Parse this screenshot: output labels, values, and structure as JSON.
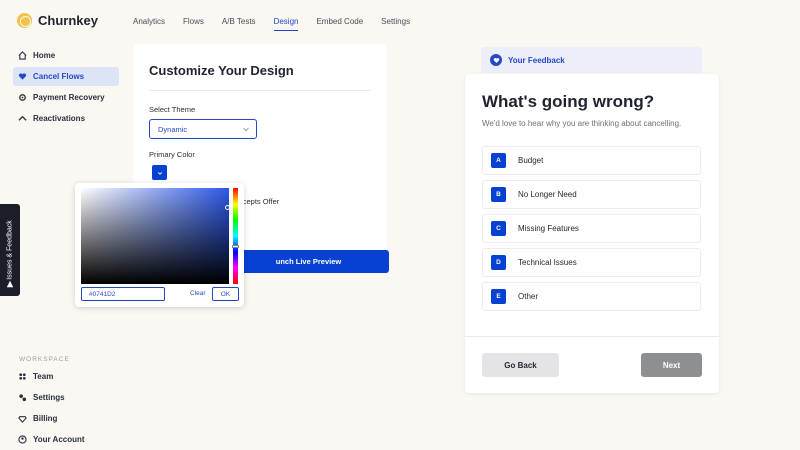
{
  "app": {
    "name": "Churnkey"
  },
  "topnav": [
    "Analytics",
    "Flows",
    "A/B Tests",
    "Design",
    "Embed Code",
    "Settings"
  ],
  "topnav_active": "Design",
  "sidebar": {
    "items": [
      {
        "label": "Home",
        "icon": "home-icon"
      },
      {
        "label": "Cancel Flows",
        "icon": "heart-icon",
        "active": true
      },
      {
        "label": "Payment Recovery",
        "icon": "gear-icon"
      },
      {
        "label": "Reactivations",
        "icon": "arrow-up-icon"
      }
    ],
    "workspace_label": "WORKSPACE",
    "workspace_items": [
      {
        "label": "Team",
        "icon": "team-icon"
      },
      {
        "label": "Settings",
        "icon": "settings-icon"
      },
      {
        "label": "Billing",
        "icon": "diamond-icon"
      },
      {
        "label": "Your Account",
        "icon": "account-icon"
      }
    ]
  },
  "design": {
    "title": "Customize Your Design",
    "theme_label": "Select Theme",
    "theme_value": "Dynamic",
    "primary_color_label": "Primary Color",
    "accepts_offer_text": "ccepts Offer",
    "launch_button": "unch Live Preview"
  },
  "picker": {
    "hex_value": "#0741D2",
    "clear_label": "Clear",
    "ok_label": "OK"
  },
  "issues_tab": {
    "label": "Issues & Feedback"
  },
  "preview": {
    "tab_label": "Your Feedback",
    "question": "What's going wrong?",
    "subtitle": "We'd love to hear why you are thinking about cancelling.",
    "options": [
      {
        "letter": "A",
        "text": "Budget"
      },
      {
        "letter": "B",
        "text": "No Longer Need"
      },
      {
        "letter": "C",
        "text": "Missing Features"
      },
      {
        "letter": "D",
        "text": "Technical Issues"
      },
      {
        "letter": "E",
        "text": "Other"
      }
    ],
    "back_label": "Go Back",
    "next_label": "Next"
  },
  "colors": {
    "primary": "#0741D2",
    "background": "#fbf7f2"
  }
}
